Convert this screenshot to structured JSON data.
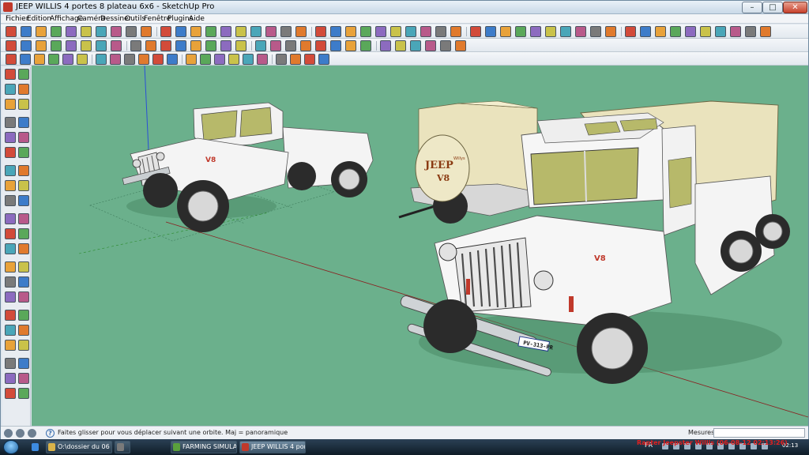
{
  "window": {
    "title": "JEEP WILLIS 4 portes 8 plateau 6x6 - SketchUp Pro",
    "controls": {
      "minimize": "–",
      "maximize": "□",
      "close": "✕"
    }
  },
  "menu": [
    "Fichier",
    "Edition",
    "Affichage",
    "Caméra",
    "Dessiner",
    "Outils",
    "Fenêtre",
    "Plugins",
    "Aide"
  ],
  "toolbar_icons": {
    "row1": [
      "select-icon",
      "eraser-icon",
      "paint-bucket-icon",
      "rectangle-icon",
      "circle-icon",
      "arc-icon",
      "polygon-icon",
      "freehand-icon",
      "line-icon",
      "move-icon",
      "push-pull-icon",
      "rotate-icon",
      "follow-me-icon",
      "scale-icon",
      "offset-icon",
      "tape-measure-icon",
      "dimension-icon",
      "protractor-icon",
      "text-icon",
      "axes-icon",
      "3d-text-icon",
      "orbit-icon",
      "pan-icon",
      "zoom-icon",
      "zoom-window-icon",
      "zoom-extents-icon",
      "previous-view-icon",
      "next-view-icon",
      "position-camera-icon",
      "walk-icon",
      "look-around-icon",
      "section-plane-icon",
      "iso-view-icon",
      "top-view-icon",
      "front-view-icon",
      "right-view-icon",
      "back-view-icon",
      "left-view-icon",
      "bottom-view-icon",
      "xray-icon",
      "wireframe-icon",
      "hidden-line-icon",
      "shaded-icon",
      "shaded-texture-icon",
      "monochrome-icon",
      "shadows-icon",
      "fog-icon",
      "components-icon",
      "materials-icon",
      "layers-icon"
    ],
    "row2": [
      "smooth-icon",
      "curve-icon",
      "bezier-icon",
      "spline-icon",
      "loft-icon",
      "joint-push-pull-icon",
      "round-corner-icon",
      "fredo-scale-icon",
      "sandbox-from-contours-icon",
      "sandbox-from-scratch-icon",
      "smoove-icon",
      "stamp-icon",
      "drape-icon",
      "add-detail-icon",
      "flip-edge-icon",
      "solid-union-icon",
      "solid-intersect-icon",
      "solid-subtract-icon",
      "solid-trim-icon",
      "solid-split-icon",
      "outer-shell-icon",
      "warehouse-icon",
      "extension-warehouse-icon",
      "share-model-icon",
      "dynamic-component-icon",
      "component-options-icon",
      "component-attributes-icon",
      "photo-match-icon",
      "style-builder-icon",
      "export-icon"
    ],
    "row3": [
      "line-curve-icon",
      "arrow-curve-icon",
      "weld-icon",
      "label-stray-icon",
      "curviloft-icon",
      "cleanup-icon",
      "pipe-along-path-icon",
      "window-tool-icon",
      "door-tool-icon",
      "stair-tool-icon",
      "frame-tool-icon",
      "svg-export-icon",
      "wall-tool-icon",
      "floor-tool-icon",
      "roof-tool-icon",
      "column-tool-icon",
      "beam-tool-icon",
      "joist-tool-icon",
      "rafter-tool-icon",
      "truss-tool-icon",
      "slab-tool-icon",
      "grid-tool-icon"
    ]
  },
  "left_toolbar_icons": [
    "select-icon",
    "make-component-icon",
    "paint-bucket-icon",
    "eraser-icon",
    "rectangle-icon",
    "line-icon",
    "circle-icon",
    "arc-icon",
    "polygon-icon",
    "freehand-icon",
    "move-icon",
    "push-pull-icon",
    "rotate-icon",
    "follow-me-icon",
    "scale-icon",
    "offset-icon",
    "tape-measure-icon",
    "dimension-icon",
    "protractor-icon",
    "text-icon",
    "axes-icon",
    "3d-text-icon",
    "orbit-icon",
    "pan-icon",
    "zoom-icon",
    "zoom-window-icon",
    "zoom-extents-icon",
    "previous-view-icon",
    "position-camera-icon",
    "walk-icon",
    "look-around-icon",
    "section-plane-icon",
    "geo-location-icon",
    "photo-textures-icon",
    "sandbox-smoove-icon",
    "sandbox-stamp-icon",
    "sandbox-drape-icon",
    "sandbox-add-detail-icon",
    "sandbox-flip-edge-icon",
    "sandbox-contours-icon",
    "sandbox-scratch-icon",
    "warehouse-icon"
  ],
  "viewport": {
    "background": "#6bb08c",
    "scene_objects": [
      "jeep-pickup-small",
      "jeep-6x6-large",
      "trailer-with-canopy",
      "spare-wheel-cover"
    ],
    "spare_wheel_text": {
      "line1": "JEEP",
      "line2": "V8",
      "small": "Willys"
    },
    "license_plate": "PV-313-PR",
    "badge_v8": "V8"
  },
  "statusbar": {
    "message": "Faites glisser pour vous déplacer suivant une orbite.  Maj = panoramique",
    "mesures_label": "Mesures",
    "mesures_value": ""
  },
  "taskbar": {
    "items": [
      {
        "label": "O:\\dossier du 06 04 2...",
        "icon_color": "#d9b34a"
      },
      {
        "label": "",
        "icon_color": "#7a7a7a"
      },
      {
        "label": "FARMING SIMULAT...",
        "icon_color": "#5aa03c"
      },
      {
        "label": "JEEP WILLIS 4 portes ...",
        "icon_color": "#c0392b"
      }
    ],
    "lang": "FR",
    "clock": "02:13",
    "overlay": "Rapter Jeepster Willis (06-08-12 02:13:26)"
  },
  "colors": {
    "viewport_green": "#6bb08c",
    "canopy_cream": "#eae3bd",
    "chrome": "#cfd3d6",
    "tire": "#2b2b2b",
    "window_olive": "#b7b96a"
  }
}
